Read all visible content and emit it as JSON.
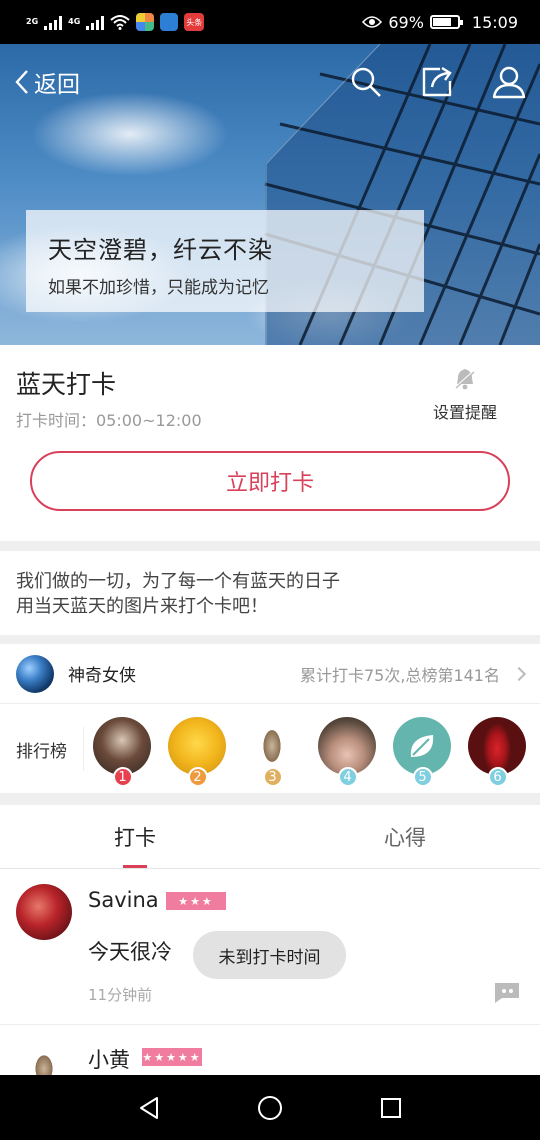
{
  "status_bar": {
    "network_1": "2G",
    "network_2": "4G",
    "app_badge": "头条",
    "battery_percent": "69%",
    "battery_level": 0.69,
    "time": "15:09"
  },
  "top_nav": {
    "back_label": "返回",
    "icons": [
      "search-icon",
      "share-icon",
      "profile-icon"
    ]
  },
  "banner": {
    "title": "天空澄碧，纤云不染",
    "subtitle": "如果不加珍惜，只能成为记忆"
  },
  "checkin": {
    "title": "蓝天打卡",
    "time_label": "打卡时间：05:00~12:00",
    "reminder_label": "设置提醒",
    "button_label": "立即打卡"
  },
  "description": {
    "line1": "我们做的一切，为了每一个有蓝天的日子",
    "line2": "用当天蓝天的图片来打个卡吧！"
  },
  "current_user": {
    "name": "神奇女侠",
    "stats": "累计打卡75次,总榜第141名"
  },
  "leaderboard": {
    "label": "排行榜",
    "items": [
      {
        "rank": "1",
        "badge_color": "#e8414e"
      },
      {
        "rank": "2",
        "badge_color": "#f09a3e"
      },
      {
        "rank": "3",
        "badge_color": "#e0b060"
      },
      {
        "rank": "4",
        "badge_color": "#7fcfe0"
      },
      {
        "rank": "5",
        "badge_color": "#7fcfe0"
      },
      {
        "rank": "6",
        "badge_color": "#7fcfe0"
      }
    ]
  },
  "tabs": [
    "打卡",
    "心得"
  ],
  "posts": [
    {
      "name": "Savina",
      "stars": "★★★",
      "text": "今天很冷",
      "time": "11分钟前"
    },
    {
      "name": "小黄",
      "stars": "★★★★★"
    }
  ],
  "toast": "未到打卡时间",
  "colors": {
    "accent": "#d9415a",
    "star_badge": "#f07da0"
  }
}
